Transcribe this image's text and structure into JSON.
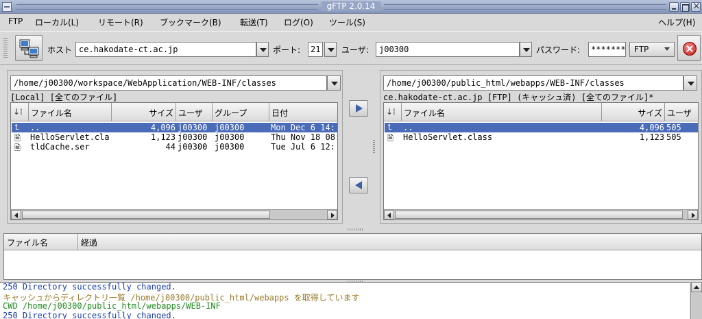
{
  "window": {
    "title": "gFTP 2.0.14"
  },
  "menu": [
    {
      "label": "FTP"
    },
    {
      "label": "ローカル(L)"
    },
    {
      "label": "リモート(R)"
    },
    {
      "label": "ブックマーク(B)"
    },
    {
      "label": "転送(T)"
    },
    {
      "label": "ログ(O)"
    },
    {
      "label": "ツール(S)"
    },
    {
      "label": "ヘルプ(H)"
    }
  ],
  "toolbar": {
    "host_label": "ホスト",
    "host_value": "ce.hakodate-ct.ac.jp",
    "port_label": "ポート:",
    "port_value": "21",
    "user_label": "ユーザ:",
    "user_value": "j00300",
    "password_label": "パスワード:",
    "password_value": "*******",
    "protocol_value": "FTP"
  },
  "local": {
    "path": "/home/j00300/workspace/WebApplication/WEB-INF/classes",
    "status": "[Local] [全てのファイル]",
    "columns": {
      "name": "ファイル名",
      "size": "サイズ",
      "user": "ユーザ",
      "group": "グループ",
      "date": "日付"
    },
    "rows": [
      {
        "name": "..",
        "size": "4,096",
        "user": "j00300",
        "group": "j00300",
        "date": "Mon Dec  6 14:",
        "type": "up"
      },
      {
        "name": "HelloServlet.cla",
        "size": "1,123",
        "user": "j00300",
        "group": "j00300",
        "date": "Thu Nov 18 08:",
        "type": "file"
      },
      {
        "name": "tldCache.ser",
        "size": "44",
        "user": "j00300",
        "group": "j00300",
        "date": "Tue Jul  6 12:",
        "type": "file"
      }
    ]
  },
  "remote": {
    "path": "/home/j00300/public_html/webapps/WEB-INF/classes",
    "status": "ce.hakodate-ct.ac.jp [FTP] (キャッシュ済) [全てのファイル]*",
    "columns": {
      "name": "ファイル名",
      "size": "サイズ",
      "user": "ユーザ"
    },
    "rows": [
      {
        "name": "..",
        "size": "4,096",
        "user": "505",
        "type": "up"
      },
      {
        "name": "HelloServlet.class",
        "size": "1,123",
        "user": "505",
        "type": "file"
      }
    ]
  },
  "transfers": {
    "columns": {
      "name": "ファイル名",
      "progress": "経過"
    }
  },
  "log": [
    {
      "text": "250 Directory successfully changed.",
      "color": "#1a3fb0"
    },
    {
      "text": "キャッシュからディレクトリ一覧 /home/j00300/public_html/webapps を取得しています",
      "color": "#9a7a2a"
    },
    {
      "text": "CWD /home/j00300/public_html/webapps/WEB-INF",
      "color": "#1f8a1f"
    },
    {
      "text": "250 Directory successfully changed.",
      "color": "#1a3fb0"
    }
  ],
  "colors": {
    "selection": "#4a6bb7",
    "titlebar": "#8e9cc0"
  },
  "icons": {
    "connect": "network-computers-icon",
    "stop": "stop-icon",
    "upload": "arrow-right-icon",
    "download": "arrow-left-icon"
  }
}
